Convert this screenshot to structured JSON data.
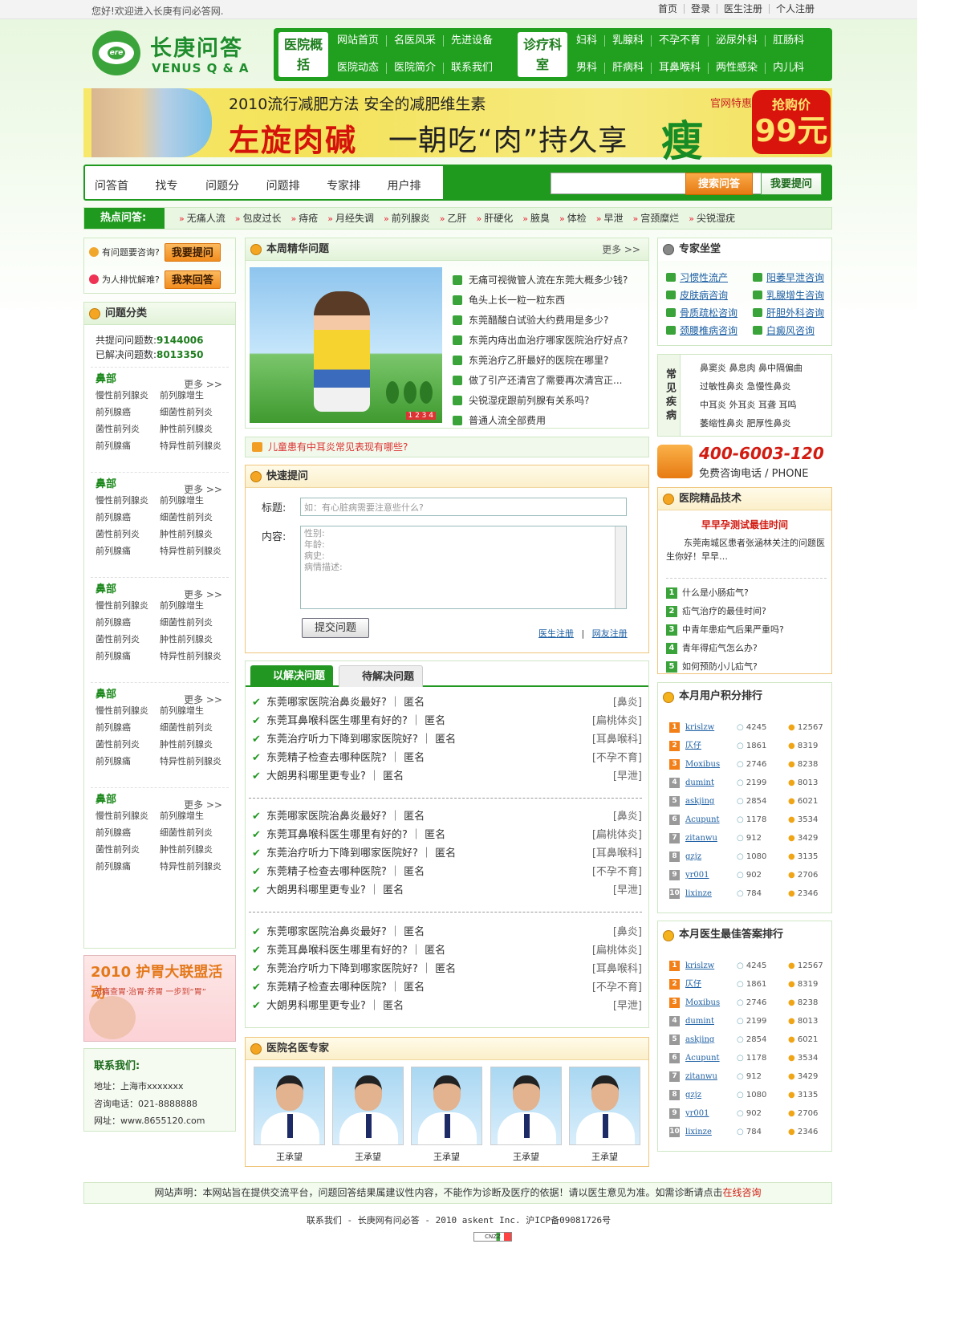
{
  "topbar": {
    "welcome": "您好!欢迎进入长庚有问必答网.",
    "links": [
      "首页",
      "登录",
      "医生注册",
      "个人注册"
    ]
  },
  "logo": {
    "cn": "长庚问答",
    "en": "VENUS Q & A",
    "mark": "ere"
  },
  "nav": {
    "block1": "医院概括",
    "row1a": [
      "网站首页",
      "名医风采",
      "先进设备"
    ],
    "row1b": [
      "医院动态",
      "医院简介",
      "联系我们"
    ],
    "block2": "诊疗科室",
    "row2a": [
      "妇科",
      "乳腺科",
      "不孕不育",
      "泌尿外科",
      "肛肠科"
    ],
    "row2b": [
      "男科",
      "肝病科",
      "耳鼻喉科",
      "两性感染",
      "内儿科"
    ]
  },
  "banner": {
    "line1": "2010流行减肥方法  安全的减肥维生素",
    "big": "左旋肉碱",
    "slogan": "一朝吃“肉”持久享",
    "shou": "瘦",
    "tag": "官网特惠",
    "price_label": "抢购价",
    "price": "99元"
  },
  "qbar": {
    "tabs": [
      "问答首页",
      "找专家",
      "问题分类",
      "问题排行",
      "专家排行",
      "用户排行"
    ],
    "search_btn": "搜索问答",
    "ask_btn": "我要提问"
  },
  "hot": {
    "label": "热点问答:",
    "items": [
      "无痛人流",
      "包皮过长",
      "痔疮",
      "月经失调",
      "前列腺炎",
      "乙肝",
      "肝硬化",
      "腋臭",
      "体检",
      "早泄",
      "宫颈糜烂",
      "尖锐湿疣"
    ]
  },
  "left": {
    "ask_text": "有问题要咨询?",
    "ask_btn": "我要提问",
    "ans_text": "为人排忧解难?",
    "ans_btn": "我来回答",
    "cat_title": "问题分类",
    "stat_total_label": "共提问问题数:",
    "stat_total": "9144006",
    "stat_solved_label": "已解决问题数:",
    "stat_solved": "8013350",
    "more": "更多 >>",
    "cats": [
      {
        "name": "鼻部",
        "items": [
          "慢性前列腺炎",
          "前列腺增生",
          "前列腺癌",
          "细菌性前列炎",
          "菌性前列炎",
          "肿性前列腺炎",
          "前列腺痛",
          "特异性前列腺炎"
        ]
      },
      {
        "name": "鼻部",
        "items": [
          "慢性前列腺炎",
          "前列腺增生",
          "前列腺癌",
          "细菌性前列炎",
          "菌性前列炎",
          "肿性前列腺炎",
          "前列腺痛",
          "特异性前列腺炎"
        ]
      },
      {
        "name": "鼻部",
        "items": [
          "慢性前列腺炎",
          "前列腺增生",
          "前列腺癌",
          "细菌性前列炎",
          "菌性前列炎",
          "肿性前列腺炎",
          "前列腺痛",
          "特异性前列腺炎"
        ]
      },
      {
        "name": "鼻部",
        "items": [
          "慢性前列腺炎",
          "前列腺增生",
          "前列腺癌",
          "细菌性前列炎",
          "菌性前列炎",
          "肿性前列腺炎",
          "前列腺痛",
          "特异性前列腺炎"
        ]
      },
      {
        "name": "鼻部",
        "items": [
          "慢性前列腺炎",
          "前列腺增生",
          "前列腺癌",
          "细菌性前列炎",
          "菌性前列炎",
          "肿性前列腺炎",
          "前列腺痛",
          "特异性前列腺炎"
        ]
      }
    ],
    "ad_title": "2010 护胃大联盟活动",
    "ad_sub": "无痛查胃·治胃·养胃  一步到“胃”",
    "contact_title": "联系我们:",
    "contact_lines": [
      "地址：上海市xxxxxxx",
      "咨询电话：021-8888888",
      "网址：www.8655120.com"
    ]
  },
  "weekly": {
    "title": "本周精华问题",
    "more": "更多 >>",
    "items": [
      "无痛可视微管人流在东莞大概多少钱?",
      "龟头上长一粒一粒东西",
      "东莞醋酸白试验大约费用是多少?",
      "东莞内痔出血治疗哪家医院治疗好点?",
      "东莞治疗乙肝最好的医院在哪里?",
      "做了引产还清宫了需要再次清宫正...",
      "尖锐湿疣跟前列腺有关系吗?",
      "普通人流全部费用"
    ],
    "pic_nums": "1 2 3 4"
  },
  "notice": "儿童患有中耳炎常见表现有哪些?",
  "fast": {
    "title": "快速提问",
    "title_label": "标题:",
    "title_ph": "如：有心脏病需要注意些什么?",
    "content_label": "内容:",
    "content_ph_lines": [
      "性别:",
      "年龄:",
      "病史:",
      "病情描述:"
    ],
    "submit": "提交问题",
    "doc_reg": "医生注册",
    "friend_reg": "网友注册"
  },
  "answers": {
    "tab1": "以解决问题",
    "tab2": "待解决问题",
    "groups": [
      [
        {
          "q": "东莞哪家医院治鼻炎最好?",
          "u": "匿名",
          "c": "[鼻炎]"
        },
        {
          "q": "东莞耳鼻喉科医生哪里有好的?",
          "u": "匿名",
          "c": "[扁桃体炎]"
        },
        {
          "q": "东莞治疗听力下降到哪家医院好?",
          "u": "匿名",
          "c": "[耳鼻喉科]"
        },
        {
          "q": "东莞精子检查去哪种医院?",
          "u": "匿名",
          "c": "[不孕不育]"
        },
        {
          "q": "大朗男科哪里更专业?",
          "u": "匿名",
          "c": "[早泄]"
        }
      ],
      [
        {
          "q": "东莞哪家医院治鼻炎最好?",
          "u": "匿名",
          "c": "[鼻炎]"
        },
        {
          "q": "东莞耳鼻喉科医生哪里有好的?",
          "u": "匿名",
          "c": "[扁桃体炎]"
        },
        {
          "q": "东莞治疗听力下降到哪家医院好?",
          "u": "匿名",
          "c": "[耳鼻喉科]"
        },
        {
          "q": "东莞精子检查去哪种医院?",
          "u": "匿名",
          "c": "[不孕不育]"
        },
        {
          "q": "大朗男科哪里更专业?",
          "u": "匿名",
          "c": "[早泄]"
        }
      ],
      [
        {
          "q": "东莞哪家医院治鼻炎最好?",
          "u": "匿名",
          "c": "[鼻炎]"
        },
        {
          "q": "东莞耳鼻喉科医生哪里有好的?",
          "u": "匿名",
          "c": "[扁桃体炎]"
        },
        {
          "q": "东莞治疗听力下降到哪家医院好?",
          "u": "匿名",
          "c": "[耳鼻喉科]"
        },
        {
          "q": "东莞精子检查去哪种医院?",
          "u": "匿名",
          "c": "[不孕不育]"
        },
        {
          "q": "大朗男科哪里更专业?",
          "u": "匿名",
          "c": "[早泄]"
        }
      ]
    ]
  },
  "docs": {
    "title": "医院名医专家",
    "names": [
      "王承望",
      "王承望",
      "王承望",
      "王承望",
      "王承望"
    ]
  },
  "experts": {
    "title": "专家坐堂",
    "items": [
      "习惯性流产",
      "阳萎早泄咨询",
      "皮肤病咨询",
      "乳腺增生咨询",
      "骨质疏松咨询",
      "肝胆外科咨询",
      "颈腰椎病咨询",
      "白癜风咨询"
    ]
  },
  "common": {
    "label": "常见疾病",
    "lines": [
      "鼻窦炎  鼻息肉  鼻中隔偏曲",
      "过敏性鼻炎  急慢性鼻炎",
      "中耳炎  外耳炎  耳聋  耳鸣",
      "萎缩性鼻炎  肥厚性鼻炎"
    ]
  },
  "phone": {
    "number": "400-6003-120",
    "sub": "免费咨询电话 / PHONE"
  },
  "tech": {
    "title": "医院精品技术",
    "headline": "早早孕测试最佳时间",
    "text": "东莞南城区患者张涵林关注的问题医生你好！早早…",
    "items": [
      "什么是小肠疝气?",
      "疝气治疗的最佳时间?",
      "中青年患疝气后果严重吗?",
      "青年得疝气怎么办?",
      "如何预防小儿疝气?"
    ]
  },
  "rank_users": {
    "title": "本月用户积分排行",
    "rows": [
      {
        "n": "1",
        "name": "krislzw",
        "a": "4245",
        "p": "12567"
      },
      {
        "n": "2",
        "name": "仄仔",
        "a": "1861",
        "p": "8319"
      },
      {
        "n": "3",
        "name": "Moxibus",
        "a": "2746",
        "p": "8238"
      },
      {
        "n": "4",
        "name": "dumint",
        "a": "2199",
        "p": "8013"
      },
      {
        "n": "5",
        "name": "askjing",
        "a": "2854",
        "p": "6021"
      },
      {
        "n": "6",
        "name": "Acupunt",
        "a": "1178",
        "p": "3534"
      },
      {
        "n": "7",
        "name": "zitanwu",
        "a": "912",
        "p": "3429"
      },
      {
        "n": "8",
        "name": "gzjz",
        "a": "1080",
        "p": "3135"
      },
      {
        "n": "9",
        "name": "yr001",
        "a": "902",
        "p": "2706"
      },
      {
        "n": "10",
        "name": "lixinze",
        "a": "784",
        "p": "2346"
      }
    ]
  },
  "rank_docs": {
    "title": "本月医生最佳答案排行",
    "rows": [
      {
        "n": "1",
        "name": "krislzw",
        "a": "4245",
        "p": "12567"
      },
      {
        "n": "2",
        "name": "仄仔",
        "a": "1861",
        "p": "8319"
      },
      {
        "n": "3",
        "name": "Moxibus",
        "a": "2746",
        "p": "8238"
      },
      {
        "n": "4",
        "name": "dumint",
        "a": "2199",
        "p": "8013"
      },
      {
        "n": "5",
        "name": "askjing",
        "a": "2854",
        "p": "6021"
      },
      {
        "n": "6",
        "name": "Acupunt",
        "a": "1178",
        "p": "3534"
      },
      {
        "n": "7",
        "name": "zitanwu",
        "a": "912",
        "p": "3429"
      },
      {
        "n": "8",
        "name": "gzjz",
        "a": "1080",
        "p": "3135"
      },
      {
        "n": "9",
        "name": "yr001",
        "a": "902",
        "p": "2706"
      },
      {
        "n": "10",
        "name": "lixinze",
        "a": "784",
        "p": "2346"
      }
    ]
  },
  "footer": {
    "statement": "网站声明：本网站旨在提供交流平台，问题回答结果属建议性内容，不能作为诊断及医疗的依据！请以医生意见为准。如需诊断请点击",
    "online": "在线咨询",
    "copyright": "联系我们 - 长庚网有问必答 - 2010 askent Inc. 沪ICP备09081726号",
    "cnzz": "CNZZ"
  }
}
